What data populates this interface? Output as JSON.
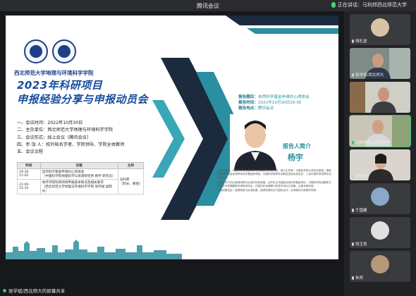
{
  "window": {
    "title": "腾讯会议",
    "speaking_label": "正在讲话：马利邦西北师范大学"
  },
  "slide": {
    "school": "西北师范大学地理与环境科学学院",
    "title_line1": "2023年科研项目",
    "title_line2": "申报经验分享与申报动员会",
    "info": [
      "一、会议时间：2022年10月30日",
      "二、主办单位：西北师范大学地理与环境科学学院",
      "三、会议形式：线上会议（腾讯会议）",
      "四、参 加 人：校外知名学者、学院领导、学院全体教师",
      "五、会议议程"
    ],
    "agenda": {
      "headers": [
        "时间",
        "议程",
        "主持"
      ],
      "rows": [
        {
          "time": "19:30-21:00",
          "items": "自然科学基金申请的心得体会\n（中国科学院地理科学与资源研究所 杨宇 研究员）",
          "host": "马利邦\n（院长、教授）"
        },
        {
          "time": "21:00-21:30",
          "items": "地环学院科研项目申报基本情况及相关要求\n（西北师范大学地理与环境科学学院 张学斌 副院长）",
          "host": ""
        }
      ]
    },
    "topic_label": "报告题目：",
    "topic_value": "自然科学基金申请的心得体会",
    "time_label": "报告时间：",
    "time_value": "2022年10月30日19:30",
    "place_label": "报告地点：",
    "place_value": "腾讯会议",
    "reporter_title": "报告人简介",
    "reporter_name": "杨宇",
    "bio": [
      "山东威海人，中国科学院地理科学与资源研究所研究员、博士生导师，中国科学院大学岗位教授。国家自然科学基金优秀青年科学基金获得者，中国科学院青年创新促进会优秀会员，入选中国科学院青年创新促进会。",
      "主要研究方向为能源地理与区域可持续发展，近年来主持国家自然科学基金项目、中国科学院战略性先导科技专项课题等多项科研项目，在国内外权威期刊发表学术论文多篇，出版专著多部。",
      "主要成果包括：能源转型与区域发展、能源资源安全与国际合作、区域规划与政策研究等。"
    ]
  },
  "share_status": "张学斌/西北师大的屏幕共享",
  "participants": [
    {
      "name": "胡礼堂",
      "active": false
    },
    {
      "name": "张学斌/西北师大",
      "active": false
    },
    {
      "name": "",
      "active": false
    },
    {
      "name": "马利邦西北师范大学",
      "active": true
    },
    {
      "name": "胡梦楚",
      "active": false
    },
    {
      "name": "于国建",
      "active": false
    },
    {
      "name": "饶玉良",
      "active": false
    },
    {
      "name": "朱宾",
      "active": false
    }
  ],
  "colors": {
    "accent": "#2a8fa0",
    "brand": "#174c9c",
    "active": "#3cc06a"
  }
}
